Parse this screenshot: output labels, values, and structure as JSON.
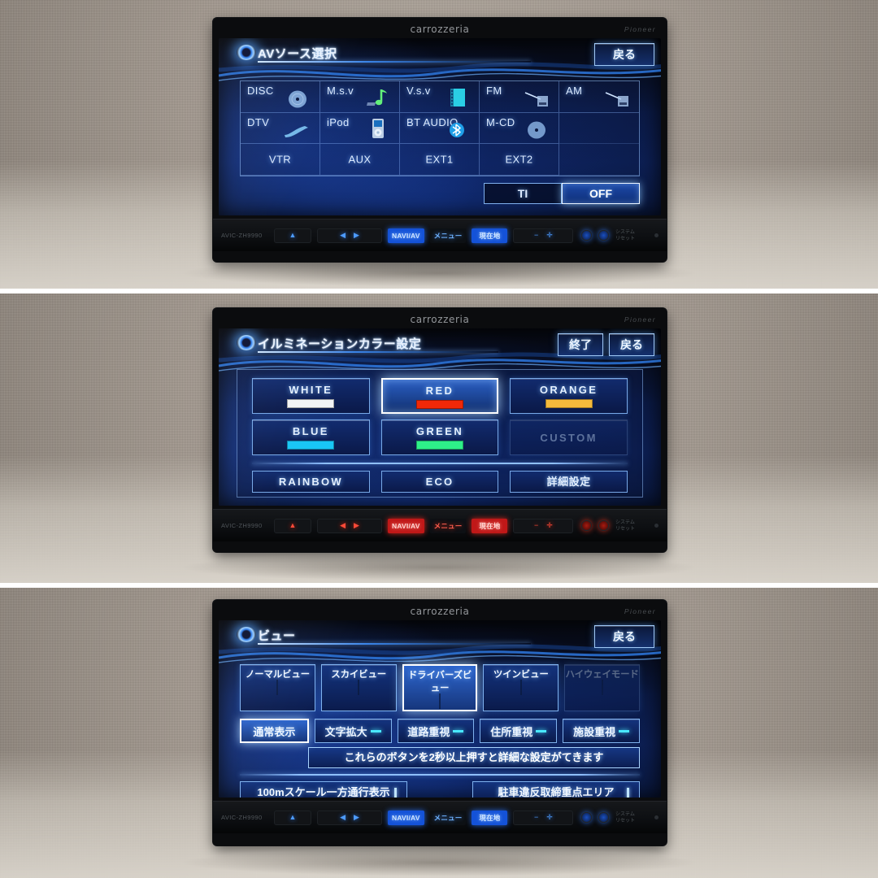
{
  "device": {
    "brand": "carrozzeria",
    "sub_brand": "Pioneer",
    "model_label": "AVIC-ZH9990"
  },
  "hardware_bar": {
    "eject_icon": "eject-icon",
    "seek_prev_icon": "seek-previous-icon",
    "seek_next_icon": "seek-next-icon",
    "navi_av_label": "NAVI/AV",
    "menu_label": "メニュー",
    "current_location_label": "現在地",
    "volume_down_icon": "volume-down-icon",
    "volume_up_icon": "volume-up-icon",
    "mic_icon": "microphone-icon",
    "power_icon": "power-icon",
    "tiny_text_1": "システム",
    "tiny_text_2": "リセット"
  },
  "panel1": {
    "title": "AVソース選択",
    "back_label": "戻る",
    "sources": [
      {
        "label": "DISC",
        "icon": "disc-icon",
        "centered": false,
        "state": "normal"
      },
      {
        "label": "M.s.v",
        "icon": "music-note-icon",
        "centered": false,
        "state": "normal"
      },
      {
        "label": "V.s.v",
        "icon": "video-film-icon",
        "centered": false,
        "state": "normal"
      },
      {
        "label": "FM",
        "icon": "radio-icon",
        "centered": false,
        "state": "normal"
      },
      {
        "label": "AM",
        "icon": "radio-icon",
        "centered": false,
        "state": "normal"
      },
      {
        "label": "DTV",
        "icon": "tv-antenna-icon",
        "centered": false,
        "state": "normal"
      },
      {
        "label": "iPod",
        "icon": "ipod-icon",
        "centered": false,
        "state": "normal"
      },
      {
        "label": "BT AUDIO",
        "icon": "bluetooth-icon",
        "centered": false,
        "state": "normal"
      },
      {
        "label": "M-CD",
        "icon": "disc-icon",
        "centered": false,
        "state": "normal"
      },
      {
        "label": "",
        "icon": "none",
        "centered": false,
        "state": "blank"
      },
      {
        "label": "VTR",
        "icon": "none",
        "centered": true,
        "state": "normal"
      },
      {
        "label": "AUX",
        "icon": "none",
        "centered": true,
        "state": "normal"
      },
      {
        "label": "EXT1",
        "icon": "none",
        "centered": true,
        "state": "normal"
      },
      {
        "label": "EXT2",
        "icon": "none",
        "centered": true,
        "state": "normal"
      },
      {
        "label": "",
        "icon": "none",
        "centered": false,
        "state": "blank"
      }
    ],
    "ti_label": "TI",
    "off_label": "OFF",
    "off_selected": true,
    "illumination": "blue"
  },
  "panel2": {
    "title": "イルミネーションカラー設定",
    "exit_label": "終了",
    "back_label": "戻る",
    "colors": [
      {
        "label": "WHITE",
        "swatch": "#f2f4f6",
        "selected": false,
        "disabled": false
      },
      {
        "label": "RED",
        "swatch": "#f02808",
        "selected": true,
        "disabled": false
      },
      {
        "label": "ORANGE",
        "swatch": "#f5ba3c",
        "selected": false,
        "disabled": false
      },
      {
        "label": "BLUE",
        "swatch": "#19c6f5",
        "selected": false,
        "disabled": false
      },
      {
        "label": "GREEN",
        "swatch": "#2ef089",
        "selected": false,
        "disabled": false
      },
      {
        "label": "CUSTOM",
        "swatch": "",
        "selected": false,
        "disabled": true
      }
    ],
    "modes": [
      {
        "label": "RAINBOW",
        "japanese": false
      },
      {
        "label": "ECO",
        "japanese": false
      },
      {
        "label": "詳細設定",
        "japanese": true
      }
    ],
    "illumination": "red"
  },
  "panel3": {
    "title": "ビュー",
    "back_label": "戻る",
    "views": [
      {
        "label": "ノーマルビュー",
        "thumb": "grid",
        "selected": false,
        "disabled": false
      },
      {
        "label": "スカイビュー",
        "thumb": "sky",
        "selected": false,
        "disabled": false
      },
      {
        "label": "ドライバーズビュー",
        "thumb": "driver",
        "selected": true,
        "disabled": false
      },
      {
        "label": "ツインビュー",
        "thumb": "twin",
        "selected": false,
        "disabled": false
      },
      {
        "label": "ハイウェイモード",
        "thumb": "hiway",
        "selected": false,
        "disabled": true
      }
    ],
    "options": [
      {
        "label": "通常表示",
        "selected": true,
        "underline": false
      },
      {
        "label": "文字拡大",
        "selected": false,
        "underline": true
      },
      {
        "label": "道路重視",
        "selected": false,
        "underline": true
      },
      {
        "label": "住所重視",
        "selected": false,
        "underline": true
      },
      {
        "label": "施設重視",
        "selected": false,
        "underline": true
      }
    ],
    "hint": "これらのボタンを2秒以上押すと詳細な設定がてきます",
    "wide_buttons": [
      {
        "label": "100mスケール一方通行表示"
      },
      {
        "label": "駐車違反取締重点エリア"
      }
    ],
    "illumination": "blue"
  }
}
